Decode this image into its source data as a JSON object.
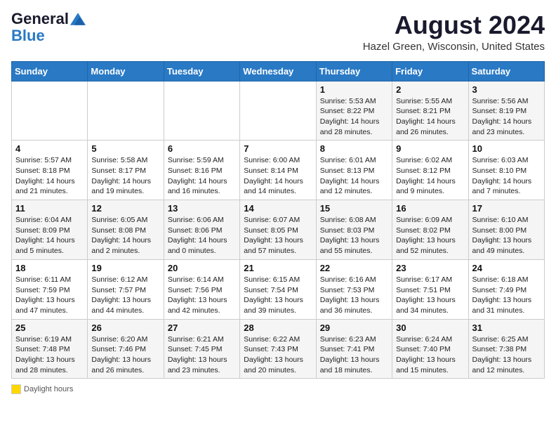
{
  "header": {
    "logo_general": "General",
    "logo_blue": "Blue",
    "month_title": "August 2024",
    "location": "Hazel Green, Wisconsin, United States"
  },
  "days_of_week": [
    "Sunday",
    "Monday",
    "Tuesday",
    "Wednesday",
    "Thursday",
    "Friday",
    "Saturday"
  ],
  "weeks": [
    [
      {
        "day": "",
        "info": ""
      },
      {
        "day": "",
        "info": ""
      },
      {
        "day": "",
        "info": ""
      },
      {
        "day": "",
        "info": ""
      },
      {
        "day": "1",
        "info": "Sunrise: 5:53 AM\nSunset: 8:22 PM\nDaylight: 14 hours and 28 minutes."
      },
      {
        "day": "2",
        "info": "Sunrise: 5:55 AM\nSunset: 8:21 PM\nDaylight: 14 hours and 26 minutes."
      },
      {
        "day": "3",
        "info": "Sunrise: 5:56 AM\nSunset: 8:19 PM\nDaylight: 14 hours and 23 minutes."
      }
    ],
    [
      {
        "day": "4",
        "info": "Sunrise: 5:57 AM\nSunset: 8:18 PM\nDaylight: 14 hours and 21 minutes."
      },
      {
        "day": "5",
        "info": "Sunrise: 5:58 AM\nSunset: 8:17 PM\nDaylight: 14 hours and 19 minutes."
      },
      {
        "day": "6",
        "info": "Sunrise: 5:59 AM\nSunset: 8:16 PM\nDaylight: 14 hours and 16 minutes."
      },
      {
        "day": "7",
        "info": "Sunrise: 6:00 AM\nSunset: 8:14 PM\nDaylight: 14 hours and 14 minutes."
      },
      {
        "day": "8",
        "info": "Sunrise: 6:01 AM\nSunset: 8:13 PM\nDaylight: 14 hours and 12 minutes."
      },
      {
        "day": "9",
        "info": "Sunrise: 6:02 AM\nSunset: 8:12 PM\nDaylight: 14 hours and 9 minutes."
      },
      {
        "day": "10",
        "info": "Sunrise: 6:03 AM\nSunset: 8:10 PM\nDaylight: 14 hours and 7 minutes."
      }
    ],
    [
      {
        "day": "11",
        "info": "Sunrise: 6:04 AM\nSunset: 8:09 PM\nDaylight: 14 hours and 5 minutes."
      },
      {
        "day": "12",
        "info": "Sunrise: 6:05 AM\nSunset: 8:08 PM\nDaylight: 14 hours and 2 minutes."
      },
      {
        "day": "13",
        "info": "Sunrise: 6:06 AM\nSunset: 8:06 PM\nDaylight: 14 hours and 0 minutes."
      },
      {
        "day": "14",
        "info": "Sunrise: 6:07 AM\nSunset: 8:05 PM\nDaylight: 13 hours and 57 minutes."
      },
      {
        "day": "15",
        "info": "Sunrise: 6:08 AM\nSunset: 8:03 PM\nDaylight: 13 hours and 55 minutes."
      },
      {
        "day": "16",
        "info": "Sunrise: 6:09 AM\nSunset: 8:02 PM\nDaylight: 13 hours and 52 minutes."
      },
      {
        "day": "17",
        "info": "Sunrise: 6:10 AM\nSunset: 8:00 PM\nDaylight: 13 hours and 49 minutes."
      }
    ],
    [
      {
        "day": "18",
        "info": "Sunrise: 6:11 AM\nSunset: 7:59 PM\nDaylight: 13 hours and 47 minutes."
      },
      {
        "day": "19",
        "info": "Sunrise: 6:12 AM\nSunset: 7:57 PM\nDaylight: 13 hours and 44 minutes."
      },
      {
        "day": "20",
        "info": "Sunrise: 6:14 AM\nSunset: 7:56 PM\nDaylight: 13 hours and 42 minutes."
      },
      {
        "day": "21",
        "info": "Sunrise: 6:15 AM\nSunset: 7:54 PM\nDaylight: 13 hours and 39 minutes."
      },
      {
        "day": "22",
        "info": "Sunrise: 6:16 AM\nSunset: 7:53 PM\nDaylight: 13 hours and 36 minutes."
      },
      {
        "day": "23",
        "info": "Sunrise: 6:17 AM\nSunset: 7:51 PM\nDaylight: 13 hours and 34 minutes."
      },
      {
        "day": "24",
        "info": "Sunrise: 6:18 AM\nSunset: 7:49 PM\nDaylight: 13 hours and 31 minutes."
      }
    ],
    [
      {
        "day": "25",
        "info": "Sunrise: 6:19 AM\nSunset: 7:48 PM\nDaylight: 13 hours and 28 minutes."
      },
      {
        "day": "26",
        "info": "Sunrise: 6:20 AM\nSunset: 7:46 PM\nDaylight: 13 hours and 26 minutes."
      },
      {
        "day": "27",
        "info": "Sunrise: 6:21 AM\nSunset: 7:45 PM\nDaylight: 13 hours and 23 minutes."
      },
      {
        "day": "28",
        "info": "Sunrise: 6:22 AM\nSunset: 7:43 PM\nDaylight: 13 hours and 20 minutes."
      },
      {
        "day": "29",
        "info": "Sunrise: 6:23 AM\nSunset: 7:41 PM\nDaylight: 13 hours and 18 minutes."
      },
      {
        "day": "30",
        "info": "Sunrise: 6:24 AM\nSunset: 7:40 PM\nDaylight: 13 hours and 15 minutes."
      },
      {
        "day": "31",
        "info": "Sunrise: 6:25 AM\nSunset: 7:38 PM\nDaylight: 13 hours and 12 minutes."
      }
    ]
  ],
  "footer": {
    "daylight_label": "Daylight hours"
  }
}
